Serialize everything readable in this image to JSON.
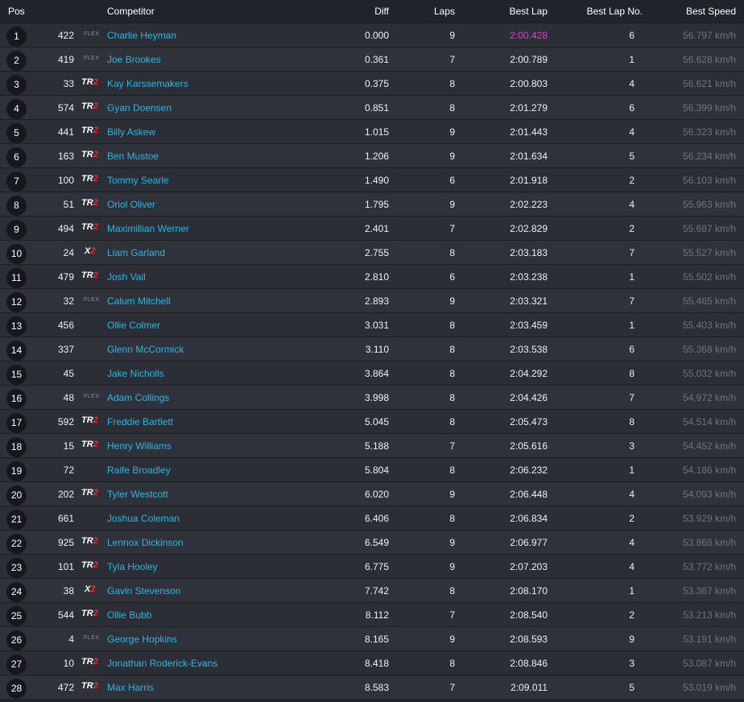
{
  "header": {
    "pos": "Pos",
    "competitor": "Competitor",
    "diff": "Diff",
    "laps": "Laps",
    "best_lap": "Best Lap",
    "best_lap_no": "Best Lap No.",
    "best_speed": "Best Speed"
  },
  "colors": {
    "background": "#21232b",
    "row_even": "#2b2e37",
    "row_odd": "#2f323b",
    "link": "#2bb6e0",
    "fastest_lap": "#e340c9",
    "class_accent": "#e03434"
  },
  "rows": [
    {
      "pos": "1",
      "number": "422",
      "class": "flex",
      "class_label": "FLEX",
      "name": "Charlie Heyman",
      "diff": "0.000",
      "laps": "9",
      "best_lap": "2:00.428",
      "best_lap_no": "6",
      "best_speed": "56.797 km/h"
    },
    {
      "pos": "2",
      "number": "419",
      "class": "flex",
      "class_label": "FLEX",
      "name": "Joe Brookes",
      "diff": "0.361",
      "laps": "7",
      "best_lap": "2:00.789",
      "best_lap_no": "1",
      "best_speed": "56.628 km/h"
    },
    {
      "pos": "3",
      "number": "33",
      "class": "tr2",
      "class_label": "TR2",
      "name": "Kay Karssemakers",
      "diff": "0.375",
      "laps": "8",
      "best_lap": "2:00.803",
      "best_lap_no": "4",
      "best_speed": "56.621 km/h"
    },
    {
      "pos": "4",
      "number": "574",
      "class": "tr2",
      "class_label": "TR2",
      "name": "Gyan Doensen",
      "diff": "0.851",
      "laps": "8",
      "best_lap": "2:01.279",
      "best_lap_no": "6",
      "best_speed": "56.399 km/h"
    },
    {
      "pos": "5",
      "number": "441",
      "class": "tr2",
      "class_label": "TR2",
      "name": "Billy Askew",
      "diff": "1.015",
      "laps": "9",
      "best_lap": "2:01.443",
      "best_lap_no": "4",
      "best_speed": "56.323 km/h"
    },
    {
      "pos": "6",
      "number": "163",
      "class": "tr2",
      "class_label": "TR2",
      "name": "Ben Mustoe",
      "diff": "1.206",
      "laps": "9",
      "best_lap": "2:01.634",
      "best_lap_no": "5",
      "best_speed": "56.234 km/h"
    },
    {
      "pos": "7",
      "number": "100",
      "class": "tr2",
      "class_label": "TR2",
      "name": "Tommy Searle",
      "diff": "1.490",
      "laps": "6",
      "best_lap": "2:01.918",
      "best_lap_no": "2",
      "best_speed": "56.103 km/h"
    },
    {
      "pos": "8",
      "number": "51",
      "class": "tr2",
      "class_label": "TR2",
      "name": "Oriol Oliver",
      "diff": "1.795",
      "laps": "9",
      "best_lap": "2:02.223",
      "best_lap_no": "4",
      "best_speed": "55.963 km/h"
    },
    {
      "pos": "9",
      "number": "494",
      "class": "tr2",
      "class_label": "TR2",
      "name": "Maximillian Werner",
      "diff": "2.401",
      "laps": "7",
      "best_lap": "2:02.829",
      "best_lap_no": "2",
      "best_speed": "55.687 km/h"
    },
    {
      "pos": "10",
      "number": "24",
      "class": "x2",
      "class_label": "X2",
      "name": "Liam Garland",
      "diff": "2.755",
      "laps": "8",
      "best_lap": "2:03.183",
      "best_lap_no": "7",
      "best_speed": "55.527 km/h"
    },
    {
      "pos": "11",
      "number": "479",
      "class": "tr2",
      "class_label": "TR2",
      "name": "Josh Vail",
      "diff": "2.810",
      "laps": "6",
      "best_lap": "2:03.238",
      "best_lap_no": "1",
      "best_speed": "55.502 km/h"
    },
    {
      "pos": "12",
      "number": "32",
      "class": "flex",
      "class_label": "FLEX",
      "name": "Calum Mitchell",
      "diff": "2.893",
      "laps": "9",
      "best_lap": "2:03.321",
      "best_lap_no": "7",
      "best_speed": "55.465 km/h"
    },
    {
      "pos": "13",
      "number": "456",
      "class": "",
      "class_label": "",
      "name": "Ollie Colmer",
      "diff": "3.031",
      "laps": "8",
      "best_lap": "2:03.459",
      "best_lap_no": "1",
      "best_speed": "55.403 km/h"
    },
    {
      "pos": "14",
      "number": "337",
      "class": "",
      "class_label": "",
      "name": "Glenn McCormick",
      "diff": "3.110",
      "laps": "8",
      "best_lap": "2:03.538",
      "best_lap_no": "6",
      "best_speed": "55.368 km/h"
    },
    {
      "pos": "15",
      "number": "45",
      "class": "",
      "class_label": "",
      "name": "Jake Nicholls",
      "diff": "3.864",
      "laps": "8",
      "best_lap": "2:04.292",
      "best_lap_no": "8",
      "best_speed": "55.032 km/h"
    },
    {
      "pos": "16",
      "number": "48",
      "class": "flex",
      "class_label": "FLEX",
      "name": "Adam Collings",
      "diff": "3.998",
      "laps": "8",
      "best_lap": "2:04.426",
      "best_lap_no": "7",
      "best_speed": "54.972 km/h"
    },
    {
      "pos": "17",
      "number": "592",
      "class": "tr2",
      "class_label": "TR2",
      "name": "Freddie Bartlett",
      "diff": "5.045",
      "laps": "8",
      "best_lap": "2:05.473",
      "best_lap_no": "8",
      "best_speed": "54.514 km/h"
    },
    {
      "pos": "18",
      "number": "15",
      "class": "tr2",
      "class_label": "TR2",
      "name": "Henry Williams",
      "diff": "5.188",
      "laps": "7",
      "best_lap": "2:05.616",
      "best_lap_no": "3",
      "best_speed": "54.452 km/h"
    },
    {
      "pos": "19",
      "number": "72",
      "class": "",
      "class_label": "",
      "name": "Raife Broadley",
      "diff": "5.804",
      "laps": "8",
      "best_lap": "2:06.232",
      "best_lap_no": "1",
      "best_speed": "54.186 km/h"
    },
    {
      "pos": "20",
      "number": "202",
      "class": "tr2",
      "class_label": "TR2",
      "name": "Tyler Westcott",
      "diff": "6.020",
      "laps": "9",
      "best_lap": "2:06.448",
      "best_lap_no": "4",
      "best_speed": "54.093 km/h"
    },
    {
      "pos": "21",
      "number": "661",
      "class": "",
      "class_label": "",
      "name": "Joshua Coleman",
      "diff": "6.406",
      "laps": "8",
      "best_lap": "2:06.834",
      "best_lap_no": "2",
      "best_speed": "53.929 km/h"
    },
    {
      "pos": "22",
      "number": "925",
      "class": "tr2",
      "class_label": "TR2",
      "name": "Lennox Dickinson",
      "diff": "6.549",
      "laps": "9",
      "best_lap": "2:06.977",
      "best_lap_no": "4",
      "best_speed": "53.868 km/h"
    },
    {
      "pos": "23",
      "number": "101",
      "class": "tr2",
      "class_label": "TR2",
      "name": "Tyla Hooley",
      "diff": "6.775",
      "laps": "9",
      "best_lap": "2:07.203",
      "best_lap_no": "4",
      "best_speed": "53.772 km/h"
    },
    {
      "pos": "24",
      "number": "38",
      "class": "x2",
      "class_label": "X2",
      "name": "Gavin Stevenson",
      "diff": "7.742",
      "laps": "8",
      "best_lap": "2:08.170",
      "best_lap_no": "1",
      "best_speed": "53.367 km/h"
    },
    {
      "pos": "25",
      "number": "544",
      "class": "tr2",
      "class_label": "TR2",
      "name": "Ollie Bubb",
      "diff": "8.112",
      "laps": "7",
      "best_lap": "2:08.540",
      "best_lap_no": "2",
      "best_speed": "53.213 km/h"
    },
    {
      "pos": "26",
      "number": "4",
      "class": "flex",
      "class_label": "FLEX",
      "name": "George Hopkins",
      "diff": "8.165",
      "laps": "9",
      "best_lap": "2:08.593",
      "best_lap_no": "9",
      "best_speed": "53.191 km/h"
    },
    {
      "pos": "27",
      "number": "10",
      "class": "tr2",
      "class_label": "TR2",
      "name": "Jonathan Roderick-Evans",
      "diff": "8.418",
      "laps": "8",
      "best_lap": "2:08.846",
      "best_lap_no": "3",
      "best_speed": "53.087 km/h"
    },
    {
      "pos": "28",
      "number": "472",
      "class": "tr2",
      "class_label": "TR2",
      "name": "Max Harris",
      "diff": "8.583",
      "laps": "7",
      "best_lap": "2:09.011",
      "best_lap_no": "5",
      "best_speed": "53.019 km/h"
    }
  ]
}
